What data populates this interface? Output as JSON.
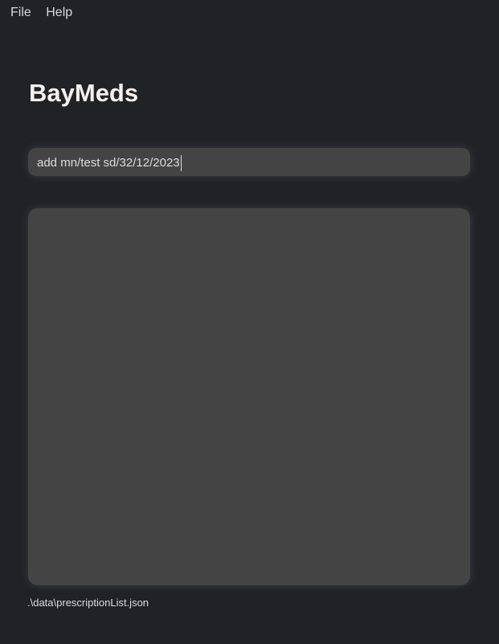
{
  "menu": {
    "file": "File",
    "help": "Help"
  },
  "app_title": "BayMeds",
  "command": {
    "value": "add mn/test sd/32/12/2023"
  },
  "status": {
    "file_path": ".\\data\\prescriptionList.json"
  }
}
